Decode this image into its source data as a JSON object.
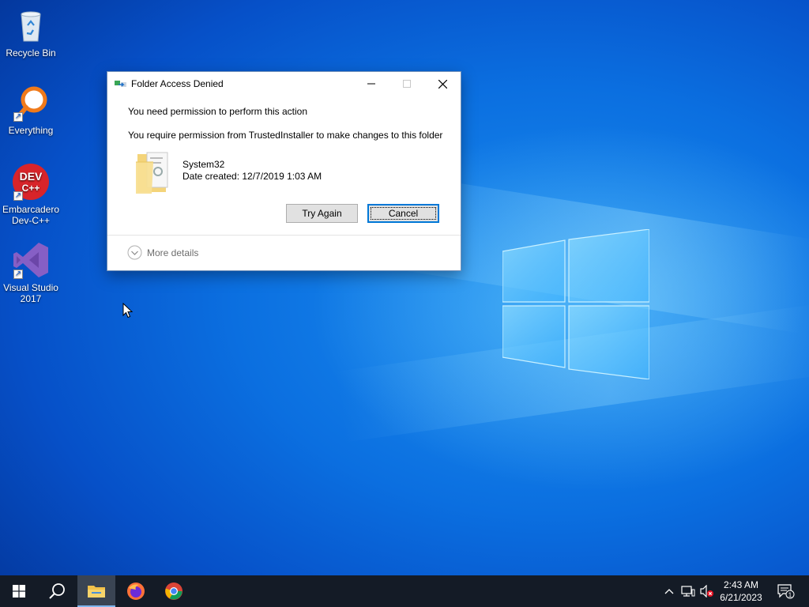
{
  "desktop": {
    "icons": [
      {
        "label": "Recycle Bin",
        "icon": "recycle-bin-icon"
      },
      {
        "label": "Everything",
        "icon": "everything-search-icon"
      },
      {
        "label": "Embarcadero Dev-C++",
        "line1": "Embarcadero",
        "line2": "Dev-C++",
        "icon": "devcpp-icon",
        "logo_text_1": "DEV",
        "logo_text_2": "C++"
      },
      {
        "label": "Visual Studio 2017",
        "line1": "Visual Studio",
        "line2": "2017",
        "icon": "visual-studio-icon"
      }
    ]
  },
  "dialog": {
    "title": "Folder Access Denied",
    "message": "You need permission to perform this action",
    "detail": "You require permission from TrustedInstaller to make changes to this folder",
    "folder_name": "System32",
    "date_created": "Date created: 12/7/2019 1:03 AM",
    "try_again_label": "Try Again",
    "cancel_label": "Cancel",
    "more_details_label": "More details"
  },
  "taskbar": {
    "pinned": [
      "start-icon",
      "search-icon",
      "file-explorer-icon",
      "firefox-icon",
      "chrome-icon"
    ],
    "active": "file-explorer-icon",
    "tray": [
      "show-hidden-icons-chevron",
      "network-icon",
      "volume-muted-icon"
    ],
    "time": "2:43 AM",
    "date": "6/21/2023",
    "notification_count": "1"
  },
  "colors": {
    "accent": "#0078d7",
    "taskbar_bg": "#141b26",
    "desktop_blue": "#0b6fe0"
  }
}
